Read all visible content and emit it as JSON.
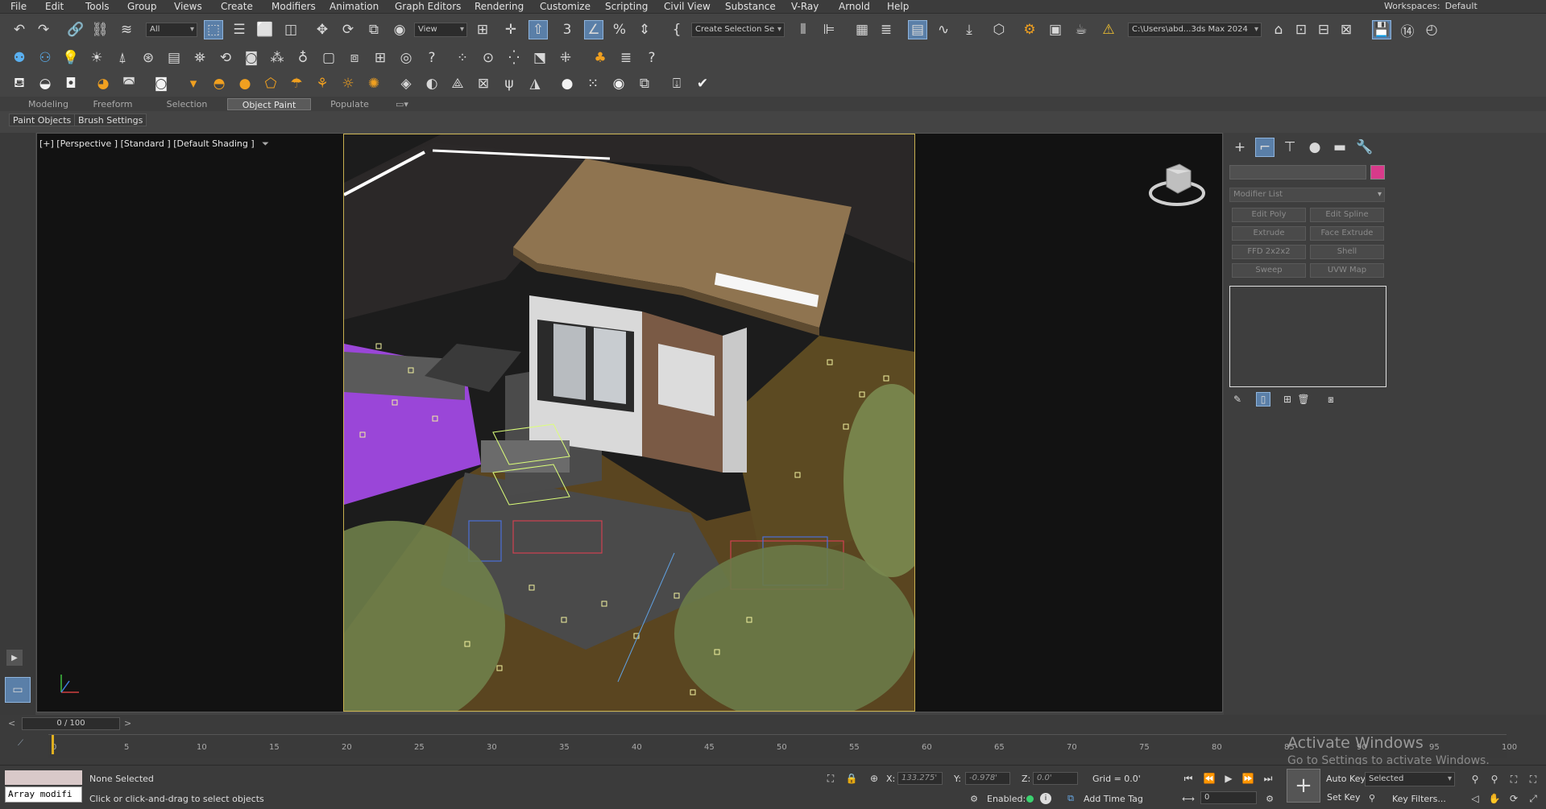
{
  "menu": [
    "File",
    "Edit",
    "Tools",
    "Group",
    "Views",
    "Create",
    "Modifiers",
    "Animation",
    "Graph Editors",
    "Rendering",
    "Customize",
    "Scripting",
    "Civil View",
    "Substance",
    "V-Ray",
    "Arnold",
    "Help"
  ],
  "workspace": {
    "label": "Workspaces:",
    "value": "Default"
  },
  "toolbar": {
    "selection_filter": "All",
    "ref_coord": "View",
    "named_selection": "Create Selection Se",
    "project_path": "C:\\Users\\abd...3ds Max 2024"
  },
  "ribbon": {
    "tabs": [
      "Modeling",
      "Freeform",
      "Selection",
      "Object Paint",
      "Populate"
    ],
    "active": "Object Paint",
    "sub_buttons": [
      "Paint Objects",
      "Brush Settings"
    ]
  },
  "viewport": {
    "label": "[+] [Perspective ] [Standard ] [Default Shading ]"
  },
  "command_panel": {
    "modifier_list": "Modifier List",
    "buttons": [
      "Edit Poly",
      "Edit Spline",
      "Extrude",
      "Face Extrude",
      "FFD 2x2x2",
      "Shell",
      "Sweep",
      "UVW Map"
    ],
    "color_swatch": "#d83a8a"
  },
  "timeline": {
    "frame": "0 / 100",
    "ticks": [
      "0",
      "5",
      "10",
      "15",
      "20",
      "25",
      "30",
      "35",
      "40",
      "45",
      "50",
      "55",
      "60",
      "65",
      "70",
      "75",
      "80",
      "85",
      "90",
      "95",
      "100"
    ]
  },
  "status": {
    "selection": "None Selected",
    "prompt": "Click or click-and-drag to select objects",
    "maxscript": "Array modifi",
    "x_label": "X:",
    "x": "133.275'",
    "y_label": "Y:",
    "y": "-0.978'",
    "z_label": "Z:",
    "z": "0.0'",
    "grid": "Grid = 0.0'",
    "enabled": "Enabled:",
    "add_time_tag": "Add Time Tag",
    "auto_key": "Auto Key",
    "set_key": "Set Key",
    "key_mode": "Selected",
    "key_filters": "Key Filters...",
    "frame_value": "0"
  },
  "watermark": {
    "title": "Activate Windows",
    "subtitle": "Go to Settings to activate Windows."
  }
}
